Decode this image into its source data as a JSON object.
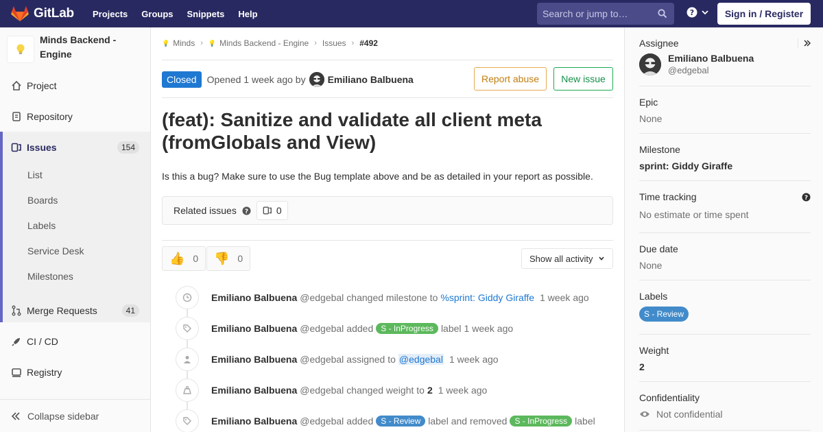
{
  "navbar": {
    "brand": "GitLab",
    "links": [
      "Projects",
      "Groups",
      "Snippets",
      "Help"
    ],
    "search_placeholder": "Search or jump to…",
    "signin_label": "Sign in / Register",
    "bg_color": "#292961"
  },
  "sidebar": {
    "project_name": "Minds Backend - Engine",
    "project_emoji": "💡",
    "items": [
      {
        "label": "Project",
        "icon": "home-icon"
      },
      {
        "label": "Repository",
        "icon": "doc-icon"
      },
      {
        "label": "Issues",
        "icon": "issues-icon",
        "count": "154",
        "active": true
      },
      {
        "label": "Merge Requests",
        "icon": "merge-request-icon",
        "count": "41"
      },
      {
        "label": "CI / CD",
        "icon": "rocket-icon"
      },
      {
        "label": "Registry",
        "icon": "container-icon"
      }
    ],
    "subitems": [
      "List",
      "Boards",
      "Labels",
      "Service Desk",
      "Milestones"
    ],
    "collapse_label": "Collapse sidebar"
  },
  "breadcrumbs": {
    "items": [
      "Minds",
      "Minds Backend - Engine",
      "Issues"
    ],
    "current": "#492"
  },
  "issue": {
    "status": "Closed",
    "opened_text": "Opened 1 week ago by",
    "author": "Emiliano Balbuena",
    "report_label": "Report abuse",
    "new_label": "New issue",
    "title": "(feat): Sanitize and validate all client meta (fromGlobals and View)",
    "description": "Is this a bug? Make sure to use the Bug template above and be as detailed in your report as possible."
  },
  "related": {
    "title": "Related issues",
    "count": "0"
  },
  "awards": {
    "thumbs_up": "0",
    "thumbs_down": "0",
    "activity_filter": "Show all activity"
  },
  "timeline": {
    "author": "Emiliano Balbuena",
    "handle": "@edgebal",
    "notes": [
      {
        "icon": "clock-icon",
        "action": "changed milestone to",
        "link": "%sprint: Giddy Giraffe",
        "time": "1 week ago"
      },
      {
        "icon": "tag-icon",
        "action": "added",
        "label": "S - InProgress",
        "suffix": "label",
        "time": "1 week ago"
      },
      {
        "icon": "user-icon",
        "action": "assigned to",
        "mention": "@edgebal",
        "time": "1 week ago"
      },
      {
        "icon": "weight-icon",
        "action": "changed weight to",
        "value": "2",
        "time": "1 week ago"
      },
      {
        "icon": "tag-icon",
        "action": "added",
        "label": "S - Review",
        "mid": "label and removed",
        "label2": "S - InProgress",
        "suffix": "label"
      }
    ]
  },
  "right_sidebar": {
    "assignee_title": "Assignee",
    "assignee_name": "Emiliano Balbuena",
    "assignee_handle": "@edgebal",
    "epic_title": "Epic",
    "epic_value": "None",
    "milestone_title": "Milestone",
    "milestone_value": "sprint: Giddy Giraffe",
    "time_title": "Time tracking",
    "time_value": "No estimate or time spent",
    "due_title": "Due date",
    "due_value": "None",
    "labels_title": "Labels",
    "label_value": "S - Review",
    "weight_title": "Weight",
    "weight_value": "2",
    "conf_title": "Confidentiality",
    "conf_value": "Not confidential"
  }
}
